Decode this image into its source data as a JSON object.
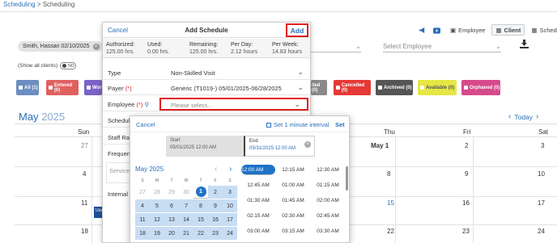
{
  "breadcrumb": {
    "root": "Scheduling",
    "sep": " > ",
    "current": "Scheduling"
  },
  "tabs": [
    {
      "label": "Employee",
      "icon": "people-icon"
    },
    {
      "label": "Client",
      "icon": "calendar-icon"
    },
    {
      "label": "Schedules",
      "icon": "calendar-icon"
    }
  ],
  "client_chip": {
    "label": "Smith, Hassan 02/10/2025"
  },
  "show_all": {
    "label": "(Show all clients)",
    "toggle": "NO"
  },
  "employee_select": {
    "placeholder": "Select Employee"
  },
  "statuses": [
    {
      "label": "All (1)",
      "color": "#6c8ec0"
    },
    {
      "label": "Entered (0)",
      "color": "#e06060"
    },
    {
      "label": "Wor",
      "color": "#7b62c7"
    },
    {
      "label": "lled (0)",
      "color": "#8a8a8a"
    },
    {
      "label": "Cancelled (0)",
      "color": "#e53935"
    },
    {
      "label": "Archived (0)",
      "color": "#555555"
    },
    {
      "label": "Available (0)",
      "color": "#e6e645"
    },
    {
      "label": "Orphaned (0)",
      "color": "#d64a8c"
    }
  ],
  "calendar": {
    "month": "May",
    "year": "2025",
    "today": "Today",
    "days": [
      "Sun",
      "Thu",
      "Fri",
      "Sat"
    ],
    "sun": [
      "27",
      "4",
      "11",
      "18"
    ],
    "thu": [
      "May 1",
      "8",
      "15",
      "22"
    ],
    "fri": [
      "2",
      "9",
      "16",
      "23"
    ],
    "sat": [
      "3",
      "10",
      "17",
      "24"
    ],
    "event_label": "Uta"
  },
  "modal": {
    "cancel": "Cancel",
    "title": "Add Schedule",
    "add": "Add",
    "stats": [
      {
        "label": "Authorized:",
        "value": "125.00 hrs."
      },
      {
        "label": "Used:",
        "value": "0.00 hrs."
      },
      {
        "label": "Remaining:",
        "value": "125.00 hrs."
      },
      {
        "label": "Per Day:",
        "value": "2.12 hours"
      },
      {
        "label": "Per Week:",
        "value": "14.83 hours"
      }
    ],
    "type_label": "Type",
    "type_value": "Non-Skilled Visit",
    "payer_label": "Payer",
    "payer_value": "Generic (T1019-) 05/01/2025-06/28/2025",
    "employee_label": "Employee",
    "employee_placeholder": "Please select...",
    "req_mark": "(*)",
    "partial_rows": [
      "Schedule",
      "Staff Rat",
      "Frequen",
      "Services",
      "Internal"
    ]
  },
  "picker": {
    "cancel": "Cancel",
    "interval": "Set 1 minute interval",
    "set": "Set",
    "start_label": "Start",
    "start_value": "05/01/2025 12:00 AM",
    "end_label": "End",
    "end_value": "05/31/2025 12:00 AM",
    "month": "May",
    "year": "2025",
    "weekdays": [
      "S",
      "M",
      "T",
      "W",
      "T",
      "F",
      "S"
    ],
    "weeks": [
      [
        "27",
        "28",
        "29",
        "30",
        "1",
        "2",
        "3"
      ],
      [
        "4",
        "5",
        "6",
        "7",
        "8",
        "9",
        "10"
      ],
      [
        "11",
        "12",
        "13",
        "14",
        "15",
        "16",
        "17"
      ],
      [
        "18",
        "19",
        "20",
        "21",
        "22",
        "23",
        "24"
      ]
    ],
    "times": [
      [
        "12:00 AM",
        "12:15 AM",
        "12:30 AM"
      ],
      [
        "12:45 AM",
        "01:00 AM",
        "01:15 AM"
      ],
      [
        "01:30 AM",
        "01:45 AM",
        "02:00 AM"
      ],
      [
        "02:15 AM",
        "02:30 AM",
        "02:45 AM"
      ],
      [
        "03:00 AM",
        "03:15 AM",
        "03:30 AM"
      ]
    ]
  },
  "colors": {
    "accent": "#2a6fb8",
    "selected": "#1f72c7",
    "range": "#c7ddf3",
    "highlight_border": "#e02020"
  }
}
